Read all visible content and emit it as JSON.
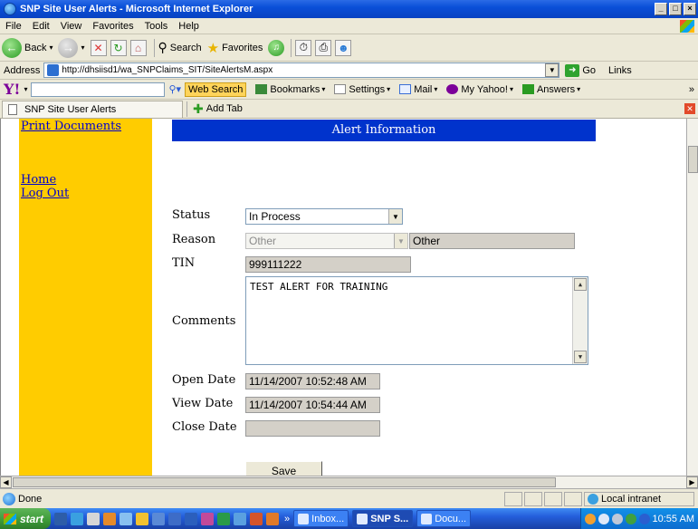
{
  "window": {
    "title": "SNP Site User Alerts - Microsoft Internet Explorer",
    "controls": [
      "_",
      "□",
      "×"
    ]
  },
  "menu": [
    "File",
    "Edit",
    "View",
    "Favorites",
    "Tools",
    "Help"
  ],
  "toolbar": {
    "back_label": "Back",
    "search_label": "Search",
    "favorites_label": "Favorites"
  },
  "address": {
    "label": "Address",
    "url": "http://dhsiisd1/wa_SNPClaims_SIT/SiteAlertsM.aspx",
    "go_label": "Go",
    "links_label": "Links"
  },
  "yahoo": {
    "logo": "Y!",
    "search_label": "Web Search",
    "bookmarks_label": "Bookmarks",
    "settings_label": "Settings",
    "mail_label": "Mail",
    "myyahoo_label": "My Yahoo!",
    "answers_label": "Answers"
  },
  "tabs": {
    "active_tab": "SNP Site User Alerts",
    "add_tab": "Add Tab"
  },
  "nav": {
    "print": "Print Documents",
    "home": "Home",
    "logout": "Log Out"
  },
  "form": {
    "header": "Alert Information",
    "status_label": "Status",
    "status_value": "In Process",
    "reason_label": "Reason",
    "reason_value": "Other",
    "reason_text": "Other",
    "tin_label": "TIN",
    "tin_value": "999111222",
    "comments_label": "Comments",
    "comments_value": "TEST ALERT FOR TRAINING",
    "open_date_label": "Open Date",
    "open_date_value": "11/14/2007 10:52:48 AM",
    "view_date_label": "View Date",
    "view_date_value": "11/14/2007 10:54:44 AM",
    "close_date_label": "Close Date",
    "close_date_value": "",
    "save_label": "Save"
  },
  "status_bar": {
    "text": "Done",
    "zone": "Local intranet"
  },
  "taskbar": {
    "start_label": "start",
    "items": [
      "Inbox...",
      "SNP S...",
      "Docu..."
    ],
    "clock": "10:55 AM"
  },
  "colors": {
    "nav_background": "#ffcc00",
    "header_background": "#0033cc",
    "link": "#0000cc"
  }
}
